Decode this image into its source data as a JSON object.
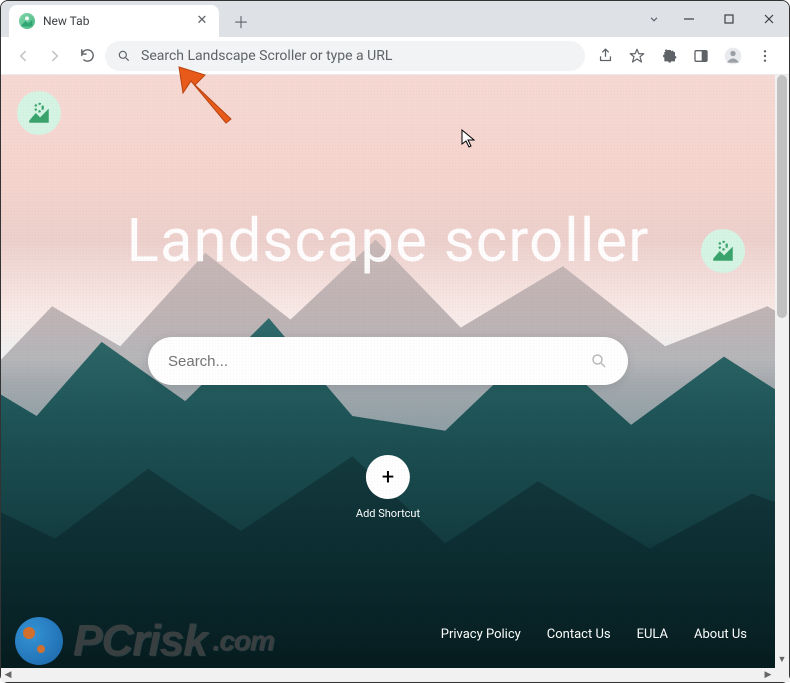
{
  "browser": {
    "tab_title": "New Tab",
    "omnibox_placeholder": "Search Landscape Scroller or type a URL"
  },
  "page": {
    "hero_title": "Landscape scroller",
    "search_placeholder": "Search...",
    "add_shortcut_label": "Add Shortcut",
    "footer_links": [
      "Privacy Policy",
      "Contact Us",
      "EULA",
      "About Us"
    ]
  },
  "watermark": {
    "brand": "PCrisk",
    "suffix": ".com"
  }
}
